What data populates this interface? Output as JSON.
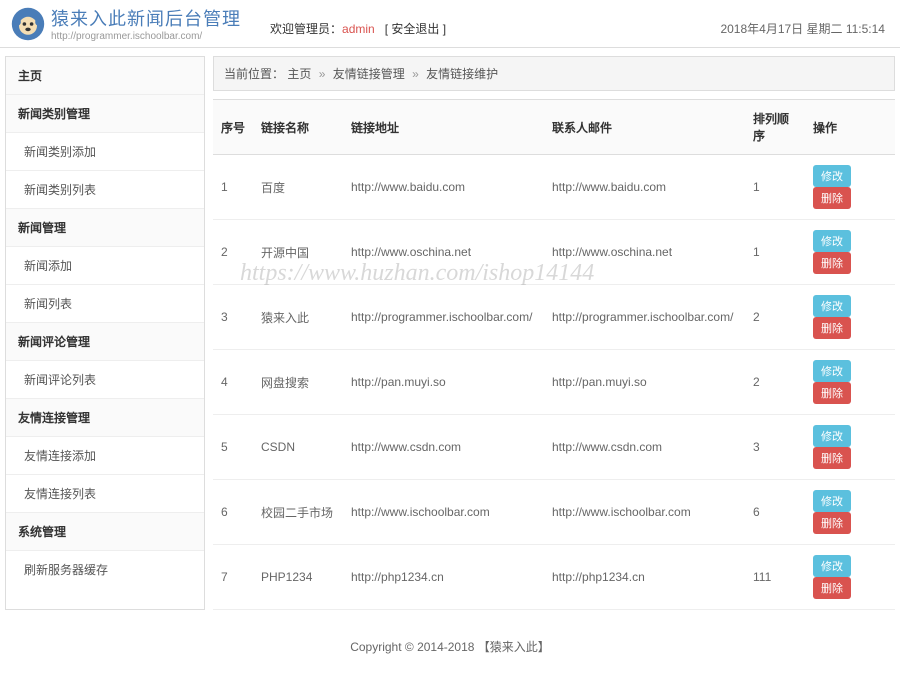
{
  "header": {
    "title": "猿来入此新闻后台管理",
    "subtitle": "http://programmer.ischoolbar.com/",
    "welcome_prefix": "欢迎管理员：",
    "admin_name": "admin",
    "logout_label": "[ 安全退出 ]",
    "datetime": "2018年4月17日 星期二 11:5:14"
  },
  "sidebar": {
    "items": [
      {
        "label": "主页",
        "type": "header"
      },
      {
        "label": "新闻类别管理",
        "type": "header"
      },
      {
        "label": "新闻类别添加",
        "type": "sub"
      },
      {
        "label": "新闻类别列表",
        "type": "sub"
      },
      {
        "label": "新闻管理",
        "type": "header"
      },
      {
        "label": "新闻添加",
        "type": "sub"
      },
      {
        "label": "新闻列表",
        "type": "sub"
      },
      {
        "label": "新闻评论管理",
        "type": "header"
      },
      {
        "label": "新闻评论列表",
        "type": "sub"
      },
      {
        "label": "友情连接管理",
        "type": "header"
      },
      {
        "label": "友情连接添加",
        "type": "sub"
      },
      {
        "label": "友情连接列表",
        "type": "sub"
      },
      {
        "label": "系统管理",
        "type": "header"
      },
      {
        "label": "刷新服务器缓存",
        "type": "sub"
      }
    ]
  },
  "breadcrumb": {
    "prefix": "当前位置：",
    "items": [
      "主页",
      "友情链接管理",
      "友情链接维护"
    ],
    "sep": "»"
  },
  "table": {
    "columns": [
      "序号",
      "链接名称",
      "链接地址",
      "联系人邮件",
      "排列顺序",
      "操作"
    ],
    "edit_label": "修改",
    "delete_label": "删除",
    "rows": [
      {
        "no": "1",
        "name": "百度",
        "url": "http://www.baidu.com",
        "email": "http://www.baidu.com",
        "order": "1"
      },
      {
        "no": "2",
        "name": "开源中国",
        "url": "http://www.oschina.net",
        "email": "http://www.oschina.net",
        "order": "1"
      },
      {
        "no": "3",
        "name": "猿来入此",
        "url": "http://programmer.ischoolbar.com/",
        "email": "http://programmer.ischoolbar.com/",
        "order": "2"
      },
      {
        "no": "4",
        "name": "网盘搜索",
        "url": "http://pan.muyi.so",
        "email": "http://pan.muyi.so",
        "order": "2"
      },
      {
        "no": "5",
        "name": "CSDN",
        "url": "http://www.csdn.com",
        "email": "http://www.csdn.com",
        "order": "3"
      },
      {
        "no": "6",
        "name": "校园二手市场",
        "url": "http://www.ischoolbar.com",
        "email": "http://www.ischoolbar.com",
        "order": "6"
      },
      {
        "no": "7",
        "name": "PHP1234",
        "url": "http://php1234.cn",
        "email": "http://php1234.cn",
        "order": "111"
      }
    ]
  },
  "footer": {
    "text": "Copyright © 2014-2018 【猿来入此】"
  },
  "watermark": "https://www.huzhan.com/ishop14144"
}
